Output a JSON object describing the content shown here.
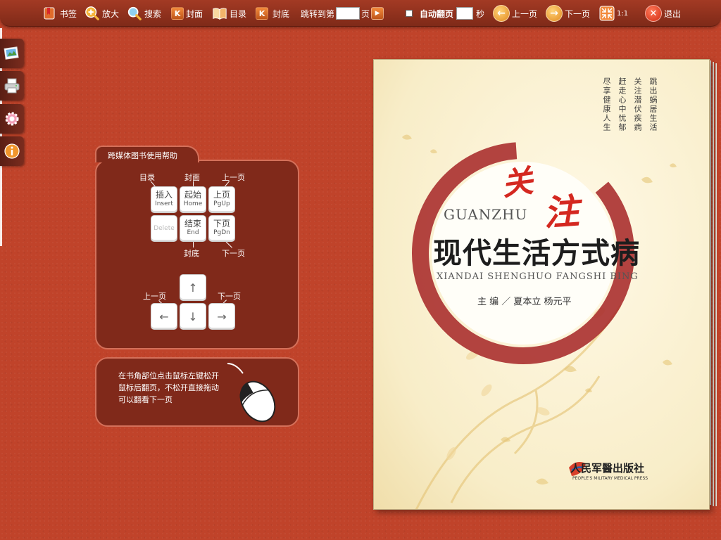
{
  "toolbar": {
    "bookmark": "书签",
    "zoom": "放大",
    "search": "搜索",
    "cover": "封面",
    "toc": "目录",
    "back_cover": "封底",
    "jump_prefix": "跳转到第",
    "jump_suffix": "页",
    "jump_value": "",
    "auto_flip": "自动翻页",
    "auto_flip_seconds": "",
    "seconds_unit": "秒",
    "prev_page": "上一页",
    "next_page": "下一页",
    "actual_size": "1:1",
    "exit": "退出"
  },
  "sidebar": {
    "items": [
      {
        "icon": "gallery-icon"
      },
      {
        "icon": "print-icon"
      },
      {
        "icon": "settings-gear-icon"
      },
      {
        "icon": "info-icon"
      }
    ]
  },
  "help": {
    "title": "跨媒体图书使用帮助",
    "labels": {
      "toc": "目录",
      "cover": "封面",
      "prev_page_top": "上一页",
      "back_cover": "封底",
      "next_page_bottom": "下一页",
      "prev_page_arrow": "上一页",
      "next_page_arrow": "下一页"
    },
    "keys": {
      "insert_cn": "插入",
      "insert_en": "Insert",
      "home_cn": "起始",
      "home_en": "Home",
      "pgup_cn": "上页",
      "pgup_en": "PgUp",
      "delete_en": "Delete",
      "end_cn": "结束",
      "end_en": "End",
      "pgdn_cn": "下页",
      "pgdn_en": "PgDn",
      "up": "↑",
      "left": "←",
      "down": "↓",
      "right": "→"
    },
    "mouse_text": "在书角部位点击鼠标左键松开鼠标后翻页，不松开直接拖动可以翻看下一页"
  },
  "book": {
    "vertical_lines": [
      "跳出蜗居生活",
      "关注潜伏疾病",
      "赶走心中忧郁",
      "尽享健康人生"
    ],
    "title_red_1": "关",
    "title_red_2": "注",
    "pinyin_1": "GUANZHU",
    "title_main": "现代生活方式病",
    "pinyin_2": "XIANDAI SHENGHUO FANGSHI BING",
    "authors": "主  编 ／ 夏本立    杨元平",
    "publisher": "人民军醫出版社",
    "publisher_en": "PEOPLE'S MILITARY MEDICAL PRESS"
  },
  "colors": {
    "background": "#c0432a",
    "panel": "#80291a",
    "panel_border": "#d4705a",
    "toolbar": "#8f3220",
    "accent_orange": "#e2891c",
    "cover_red": "#d42820"
  }
}
